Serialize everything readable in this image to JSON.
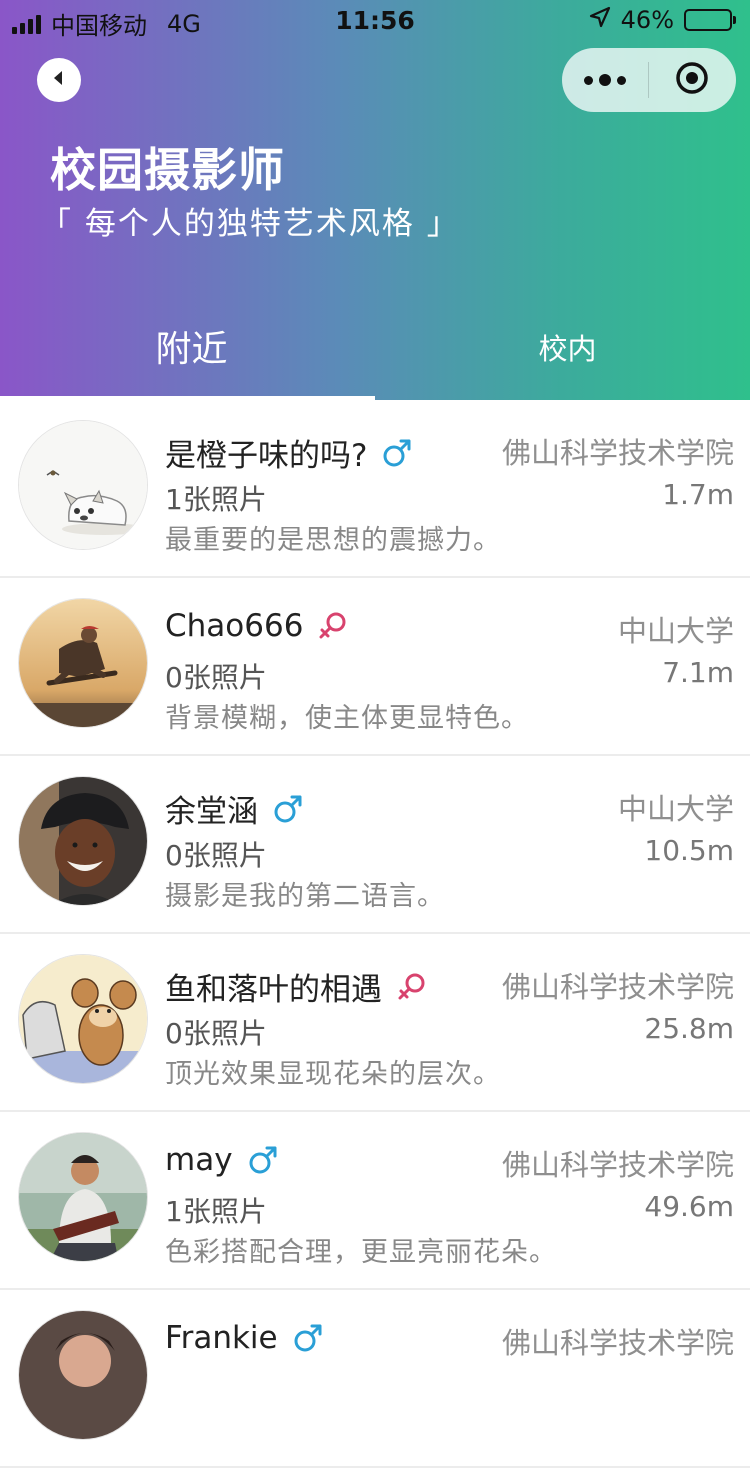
{
  "status_bar": {
    "carrier": "中国移动",
    "network": "4G",
    "time": "11:56",
    "battery": "46%",
    "battery_level": 0.46
  },
  "header": {
    "title": "校园摄影师",
    "subtitle": "「 每个人的独特艺术风格 」",
    "back_icon": "back-arrow-icon",
    "more_icon": "more-dots-icon",
    "close_icon": "target-circle-icon"
  },
  "tabs": [
    {
      "label": "附近",
      "active": true
    },
    {
      "label": "校内",
      "active": false
    }
  ],
  "photographers": [
    {
      "name": "是橙子味的吗?",
      "gender": "male",
      "school": "佛山科学技术学院",
      "photos": "1张照片",
      "distance": "1.7m",
      "bio": "最重要的是思想的震撼力。"
    },
    {
      "name": "Chao666",
      "gender": "female",
      "school": "中山大学",
      "photos": "0张照片",
      "distance": "7.1m",
      "bio": "背景模糊，使主体更显特色。"
    },
    {
      "name": "余堂涵",
      "gender": "male",
      "school": "中山大学",
      "photos": "0张照片",
      "distance": "10.5m",
      "bio": "摄影是我的第二语言。"
    },
    {
      "name": "鱼和落叶的相遇",
      "gender": "female",
      "school": "佛山科学技术学院",
      "photos": "0张照片",
      "distance": "25.8m",
      "bio": "顶光效果显现花朵的层次。"
    },
    {
      "name": "may",
      "gender": "male",
      "school": "佛山科学技术学院",
      "photos": "1张照片",
      "distance": "49.6m",
      "bio": "色彩搭配合理，更显亮丽花朵。"
    },
    {
      "name": "Frankie",
      "gender": "male",
      "school": "佛山科学技术学院",
      "photos": "",
      "distance": "",
      "bio": ""
    }
  ],
  "colors": {
    "male": "#2a9fd6",
    "female": "#d8436e",
    "gradient_start": "#8a56c8",
    "gradient_end": "#2fc08c"
  }
}
